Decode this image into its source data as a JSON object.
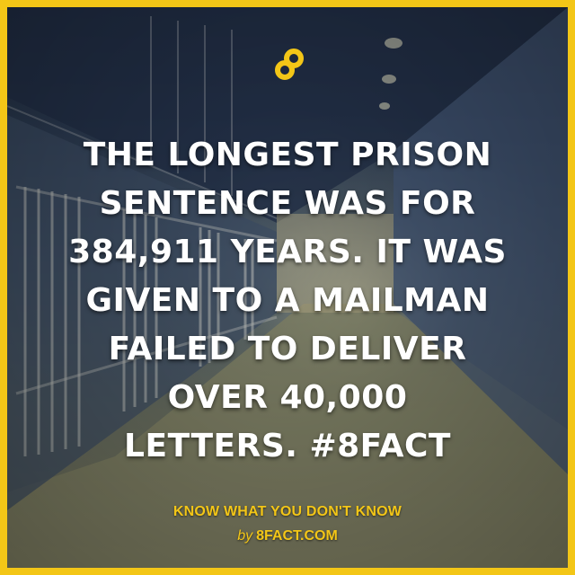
{
  "card": {
    "fact_lines": [
      "THE LONGEST PRISON",
      "SENTENCE WAS FOR",
      "384,911 YEARS. IT WAS",
      "GIVEN TO A MAILMAN",
      "FAILED TO DELIVER",
      "OVER 40,000",
      "LETTERS. #8FACT"
    ],
    "tagline": "KNOW WHAT YOU DON'T KNOW",
    "byline_prefix": "by",
    "byline_site": "8FACT.COM"
  },
  "colors": {
    "brand_yellow": "#f3c617",
    "text_white": "#ffffff"
  },
  "icons": {
    "logo": "8fact-logo-icon"
  }
}
